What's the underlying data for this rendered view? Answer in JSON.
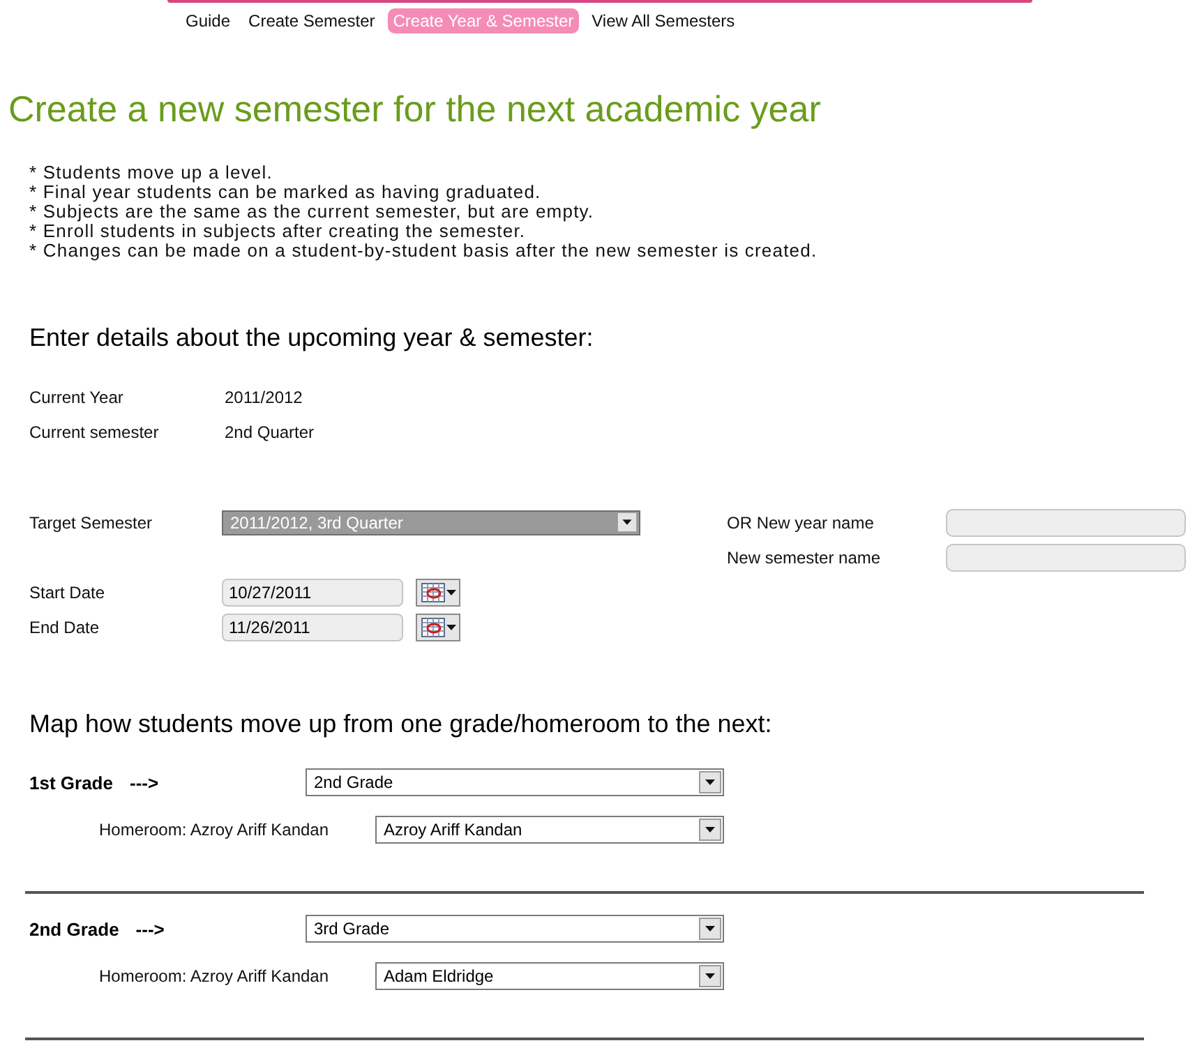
{
  "nav": {
    "items": [
      {
        "label": "Guide",
        "selected": false
      },
      {
        "label": "Create Semester",
        "selected": false
      },
      {
        "label": "Create Year & Semester",
        "selected": true
      },
      {
        "label": "View All Semesters",
        "selected": false
      }
    ]
  },
  "heading": "Create a new semester for the next academic year",
  "notes": [
    "* Students move up a level.",
    "* Final year students can be marked as having graduated.",
    "* Subjects are the same as the current semester, but are empty.",
    "* Enroll students in subjects after creating the semester.",
    "* Changes can be made on a student-by-student basis after the new semester is created."
  ],
  "details": {
    "title": "Enter details about the upcoming year & semester:",
    "current": [
      {
        "label": "Current Year",
        "value": "2011/2012"
      },
      {
        "label": "Current semester",
        "value": "2nd Quarter"
      }
    ],
    "target_semester": {
      "label": "Target Semester",
      "value": "2011/2012, 3rd Quarter",
      "focused": true
    },
    "new_names": [
      {
        "label": "OR New year name"
      },
      {
        "label": "New semester name"
      }
    ],
    "dates": [
      {
        "label": "Start Date",
        "value": "10/27/2011"
      },
      {
        "label": "End Date",
        "value": "11/26/2011"
      }
    ]
  },
  "mapping": {
    "title": "Map how students move up from one grade/homeroom to the next:",
    "grades": [
      {
        "name": "1st Grade",
        "arrow": "--->",
        "next": "2nd Grade",
        "homerooms": [
          {
            "label": "Homeroom: Azroy Ariff Kandan",
            "value": "Azroy Ariff Kandan"
          }
        ]
      },
      {
        "name": "2nd Grade",
        "arrow": "--->",
        "next": "3rd Grade",
        "homerooms": [
          {
            "label": "Homeroom: Azroy Ariff Kandan",
            "value": "Adam Eldridge"
          }
        ]
      }
    ]
  }
}
